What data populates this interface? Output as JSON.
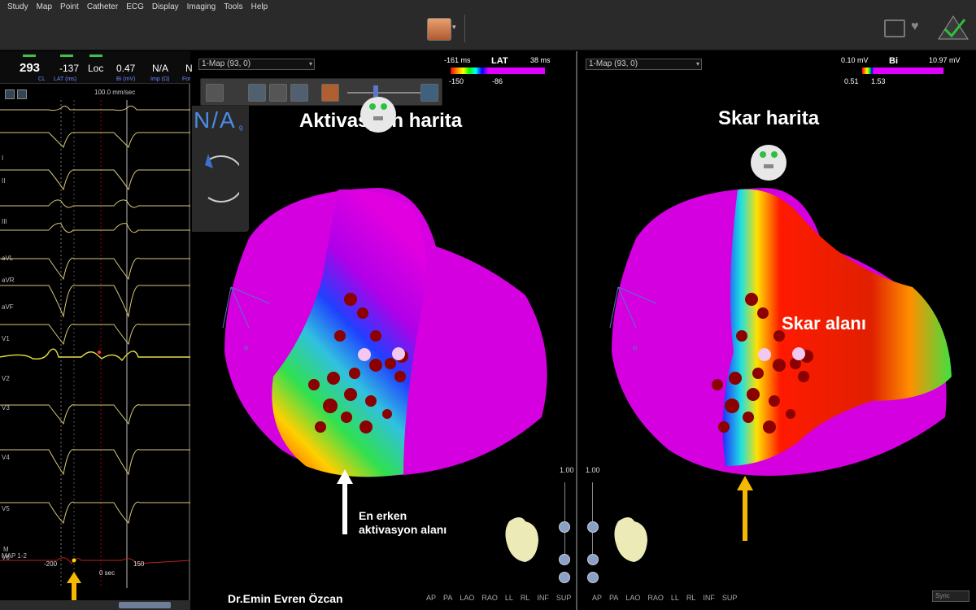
{
  "menu": [
    "Study",
    "Map",
    "Point",
    "Catheter",
    "ECG",
    "Display",
    "Imaging",
    "Tools",
    "Help"
  ],
  "ecg_header": {
    "cl_value": "293",
    "cl_label": "CL",
    "lat_value": "-137",
    "lat_label": "LAT (ms)",
    "loc_value": "Loc",
    "bi_value": "0.47",
    "bi_label": "Bi (mV)",
    "imp_value": "N/A",
    "imp_label": "Imp (Ω)",
    "force_value": "N",
    "force_label": "For"
  },
  "ecg": {
    "speed": "100.0 mm/sec",
    "leads": [
      "I",
      "II",
      "III",
      "aVL",
      "aVR",
      "aVF",
      "V1",
      "V2",
      "V3",
      "V4",
      "V5",
      "V6"
    ],
    "map_lead": "MAP 1-2",
    "map_prefix": "M",
    "time_left": "-200",
    "time_right": "150",
    "time_zero": "0 sec"
  },
  "left_panel": {
    "map_select": "1-Map (93, 0)",
    "scale_type": "LAT",
    "scale_min": "-161 ms",
    "scale_max": "38 ms",
    "scale_low": "-150",
    "scale_high": "-86",
    "title": "Aktivasyon harita",
    "na_label": "N/A",
    "na_sub": "g",
    "annotation_line1": "En erken",
    "annotation_line2": "aktivasyon alanı",
    "credit": "Dr.Emin Evren Özcan",
    "zoom": "1.00",
    "orient_label": "R",
    "slider_value": "6"
  },
  "right_panel": {
    "map_select": "1-Map (93, 0)",
    "scale_type": "Bi",
    "scale_min": "0.10 mV",
    "scale_max": "10.97 mV",
    "scale_low": "0.51",
    "scale_high": "1.53",
    "title": "Skar harita",
    "scar_label": "Skar alanı",
    "zoom": "1.00",
    "orient_label": "R",
    "sync": "Sync"
  },
  "views": [
    "AP",
    "PA",
    "LAO",
    "RAO",
    "LL",
    "RL",
    "INF",
    "SUP"
  ],
  "colors": {
    "activation_early": "#ff2a00",
    "activation_late": "#d400e0",
    "scar_low": "#ff1a00",
    "scar_high": "#d400e0",
    "annotation_arrow": "#f5b800",
    "lesion": "#8b0000"
  }
}
